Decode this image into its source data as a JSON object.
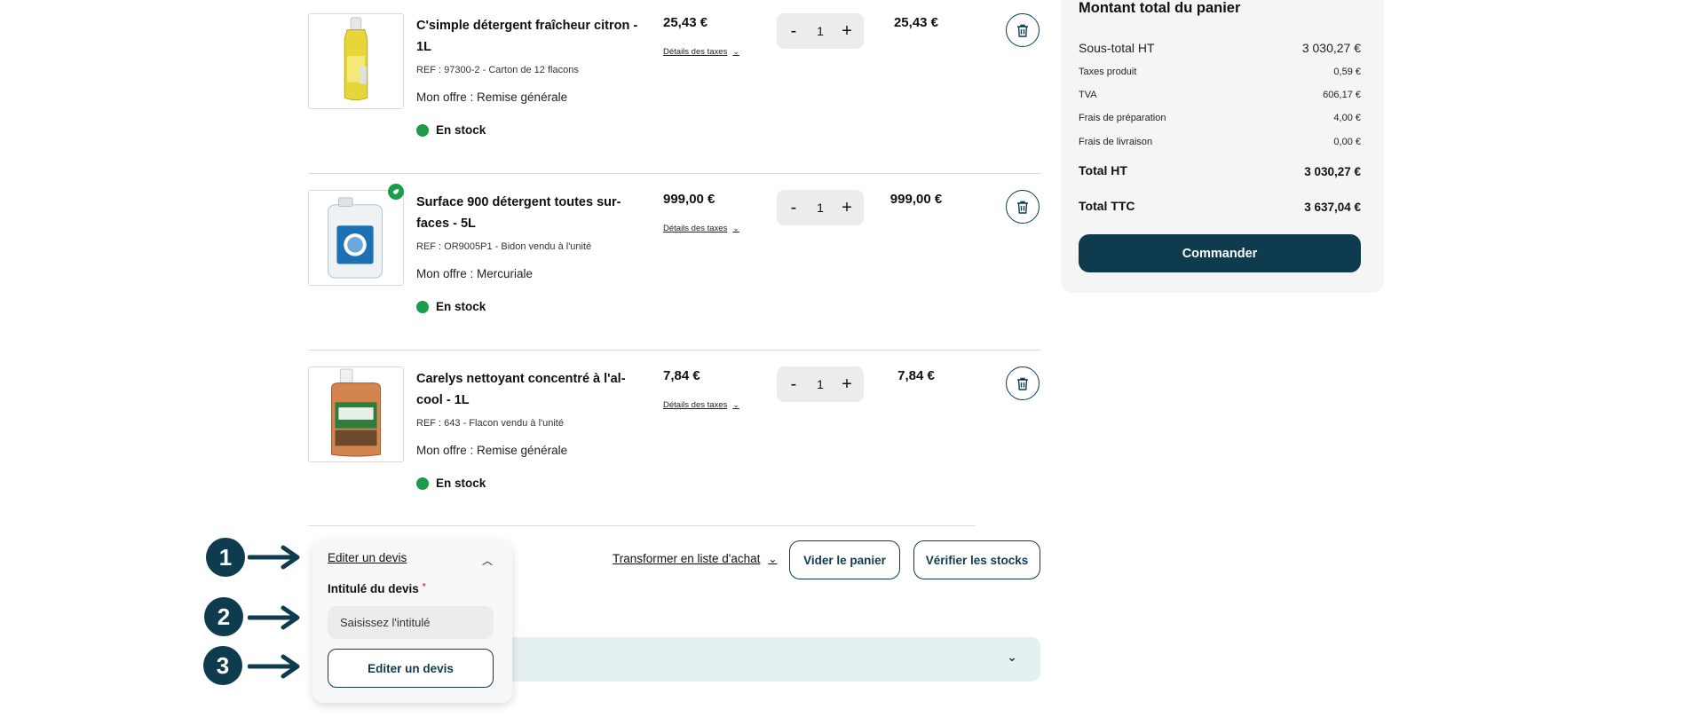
{
  "products": [
    {
      "name": "C'simple détergent fraîcheur citron - 1L",
      "ref": "REF : 97300-2  - Carton de 12 flacons",
      "offer": "Mon offre : Remise générale",
      "stock": "En stock",
      "unit_price": "25,43 €",
      "tax_link": "Détails des taxes",
      "qty": "1",
      "line_total": "25,43 €"
    },
    {
      "name": "Surface 900 détergent toutes sur-faces - 5L",
      "ref": "REF : OR9005P1  - Bidon vendu à l'unité",
      "offer": "Mon offre : Mercuriale",
      "stock": "En stock",
      "unit_price": "999,00 €",
      "tax_link": "Détails des taxes",
      "qty": "1",
      "line_total": "999,00 €"
    },
    {
      "name": "Carelys nettoyant concentré à l'al-cool - 1L",
      "ref": "REF : 643  - Flacon vendu à l'unité",
      "offer": "Mon offre : Remise générale",
      "stock": "En stock",
      "unit_price": "7,84 €",
      "tax_link": "Détails des taxes",
      "qty": "1",
      "line_total": "7,84 €"
    }
  ],
  "qty_controls": {
    "minus": "-",
    "plus": "+"
  },
  "summary": {
    "title": "Montant total du panier",
    "rows": [
      {
        "label": "Sous-total HT",
        "value": "3 030,27 €"
      },
      {
        "label": "Taxes produit",
        "value": "0,59 €"
      },
      {
        "label": "TVA",
        "value": "606,17 €"
      },
      {
        "label": "Frais de préparation",
        "value": "4,00 €"
      },
      {
        "label": "Frais de livraison",
        "value": "0,00 €"
      },
      {
        "label": "Total HT",
        "value": "3 030,27 €"
      },
      {
        "label": "Total TTC",
        "value": "3 637,04 €"
      }
    ],
    "cta": "Commander"
  },
  "actions": {
    "transform": "Transformer en liste d'achat",
    "empty_cart": "Vider le panier",
    "check_stock": "Vérifier les stocks"
  },
  "quote_popup": {
    "title": "Editer un devis",
    "field_label": "Intitulé du devis",
    "required_mark": "*",
    "placeholder": "Saisissez l'intitulé",
    "submit": "Editer un devis"
  },
  "markers": [
    "1",
    "2",
    "3"
  ],
  "colors": {
    "primary": "#0e3c4e",
    "stock_green": "#1a9c4a",
    "summary_bg": "#f5f5f5",
    "accordion_bg": "#e5f1f0"
  },
  "icons": {
    "trash": "trash-icon",
    "chevron_down": "chevron-down-icon",
    "chevron_up": "chevron-up-icon",
    "eco_badge": "eco-badge-icon"
  }
}
